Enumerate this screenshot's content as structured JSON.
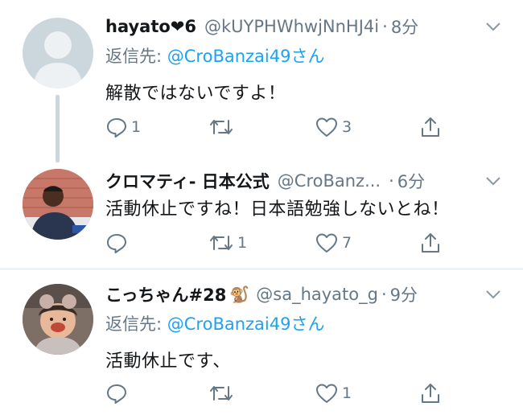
{
  "tweets": [
    {
      "name": "hayato❤6",
      "handle": "@kUYPHWhwjNnHJ4i",
      "time": "8分",
      "reply_prefix": "返信先: ",
      "reply_to": "@CroBanzai49さん",
      "text": "解散ではないですよ！",
      "replies": "1",
      "retweets": "",
      "likes": "3",
      "avatar": "default-avatar-icon"
    },
    {
      "name": "クロマティ- 日本公式",
      "handle": "@CroBanz...",
      "time": "6分",
      "reply_prefix": "",
      "reply_to": "",
      "text": "活動休止ですね！日本語勉強しないとね！",
      "replies": "",
      "retweets": "1",
      "likes": "7",
      "avatar": "profile-photo"
    },
    {
      "name": "こっちゃん#28",
      "name_emoji": "🐒",
      "handle": "@sa_hayato_g",
      "time": "9分",
      "reply_prefix": "返信先: ",
      "reply_to": "@CroBanzai49さん",
      "text": "活動休止です、",
      "replies": "",
      "retweets": "",
      "likes": "1",
      "avatar": "profile-photo"
    }
  ],
  "colors": {
    "link": "#1da1f2",
    "secondary": "#657786",
    "thread": "#ccd6dd",
    "divider": "#e1e8ed"
  }
}
